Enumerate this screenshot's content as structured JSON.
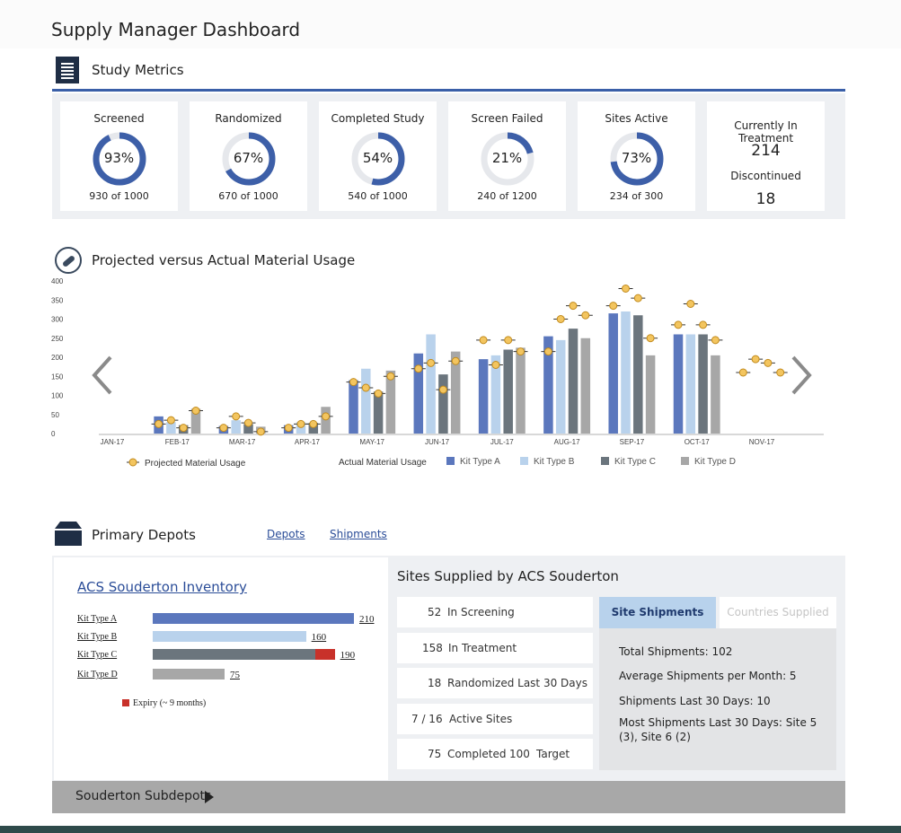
{
  "page": {
    "title": "Supply Manager Dashboard"
  },
  "study_metrics": {
    "title": "Study Metrics",
    "icon": "document-list-icon",
    "ring_color": "#3d5fa8",
    "ring_track": "#e6e8ec",
    "cards": [
      {
        "label": "Screened",
        "pct_text": "93%",
        "pct": 0.93,
        "sub": "930 of 1000"
      },
      {
        "label": "Randomized",
        "pct_text": "67%",
        "pct": 0.67,
        "sub": "670 of 1000"
      },
      {
        "label": "Completed Study",
        "pct_text": "54%",
        "pct": 0.54,
        "sub": "540 of 1000"
      },
      {
        "label": "Screen Failed",
        "pct_text": "21%",
        "pct": 0.21,
        "sub": "240 of 1200"
      },
      {
        "label": "Sites Active",
        "pct_text": "73%",
        "pct": 0.73,
        "sub": "234 of 300"
      }
    ],
    "treatment": {
      "label": "Currently In Treatment",
      "value": "214",
      "disc_label": "Discontinued",
      "disc_value": "18"
    }
  },
  "usage": {
    "title": "Projected versus Actual Material Usage",
    "icon": "pill-icon",
    "prev_icon": "chevron-left-icon",
    "next_icon": "chevron-right-icon"
  },
  "chart_data": {
    "type": "bar",
    "categories": [
      "JAN-17",
      "FEB-17",
      "MAR-17",
      "APR-17",
      "MAY-17",
      "JUN-17",
      "JUL-17",
      "AUG-17",
      "SEP-17",
      "OCT-17",
      "NOV-17"
    ],
    "ylim": [
      0,
      400
    ],
    "yticks": [
      0,
      50,
      100,
      150,
      200,
      250,
      300,
      350,
      400
    ],
    "legend_projected": "Projected Material Usage",
    "legend_actual": "Actual Material Usage",
    "series": [
      {
        "name": "Kit Type A",
        "color": "#5b77bd",
        "values": [
          null,
          45,
          20,
          22,
          140,
          210,
          195,
          255,
          315,
          260,
          null
        ]
      },
      {
        "name": "Kit Type B",
        "color": "#b9d2ec",
        "values": [
          null,
          30,
          35,
          30,
          170,
          260,
          205,
          245,
          320,
          260,
          null
        ]
      },
      {
        "name": "Kit Type C",
        "color": "#6b757d",
        "values": [
          null,
          22,
          25,
          28,
          110,
          155,
          220,
          275,
          310,
          260,
          null
        ]
      },
      {
        "name": "Kit Type D",
        "color": "#a7a7a7",
        "values": [
          null,
          65,
          18,
          70,
          165,
          215,
          225,
          250,
          205,
          205,
          null
        ]
      }
    ],
    "projected": [
      [
        null,
        25,
        15,
        15,
        135,
        170,
        245,
        215,
        335,
        285,
        160
      ],
      [
        null,
        35,
        45,
        25,
        120,
        185,
        180,
        300,
        380,
        340,
        195
      ],
      [
        null,
        15,
        28,
        25,
        105,
        115,
        245,
        335,
        355,
        285,
        185
      ],
      [
        null,
        60,
        5,
        45,
        150,
        190,
        215,
        310,
        250,
        245,
        160
      ]
    ],
    "projected_color": "#f3c55f"
  },
  "depots": {
    "title": "Primary Depots",
    "icon": "box-icon",
    "link_depots": "Depots",
    "link_shipments": "Shipments",
    "inventory_title": "ACS Souderton Inventory",
    "kits": [
      {
        "label": "Kit Type A",
        "value": "210",
        "amount": 210,
        "expiry": 0,
        "color": "#5b77bd"
      },
      {
        "label": "Kit Type B",
        "value": "160",
        "amount": 160,
        "expiry": 0,
        "color": "#b9d2ec"
      },
      {
        "label": "Kit Type C",
        "value": "190",
        "amount": 190,
        "expiry": 20,
        "color": "#6b757d"
      },
      {
        "label": "Kit Type D",
        "value": "75",
        "amount": 75,
        "expiry": 0,
        "color": "#a7a7a7"
      }
    ],
    "expiry_color": "#c8312a",
    "expiry_label": "Expiry (~ 9 months)",
    "sites_title": "Sites Supplied by ACS Souderton",
    "stats": [
      {
        "num": "52",
        "label": "In Screening"
      },
      {
        "num": "158",
        "label": "In Treatment"
      },
      {
        "num": "18",
        "label": "Randomized Last 30 Days"
      },
      {
        "num": "7 / 16",
        "label": "Active Sites"
      },
      {
        "num": "75",
        "label": "Completed",
        "num2": "100",
        "label2": "Target"
      }
    ],
    "tab_active": "Site Shipments",
    "tab_inactive": "Countries Supplied",
    "shipments": {
      "total": "Total Shipments:  102",
      "avg": "Average Shipments per Month: 5",
      "last30": "Shipments Last 30 Days: 10",
      "most": "Most Shipments Last 30 Days: Site 5 (3), Site 6 (2)"
    },
    "subdepots_label": "Souderton Subdepots"
  }
}
